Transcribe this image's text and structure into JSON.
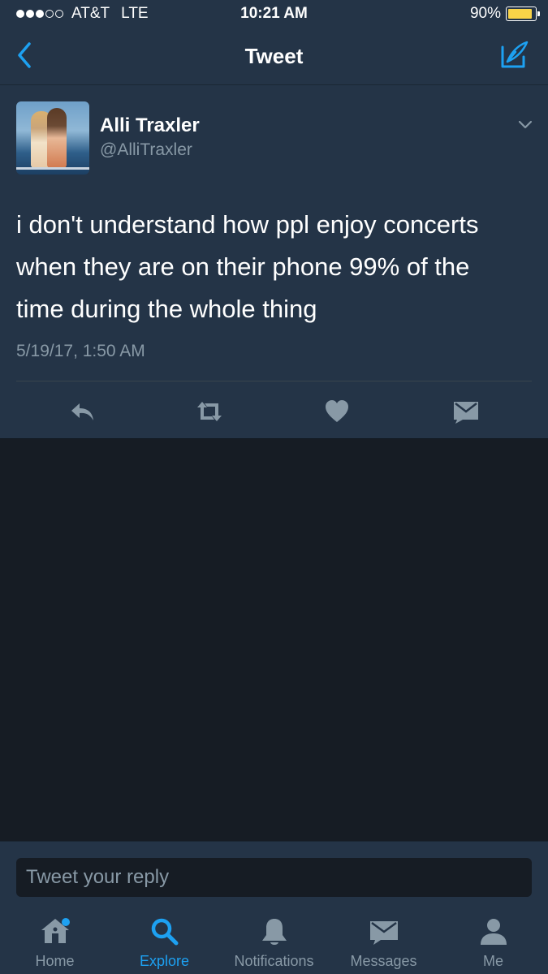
{
  "status_bar": {
    "carrier": "AT&T",
    "network": "LTE",
    "time": "10:21 AM",
    "battery": "90%",
    "signal_bars_filled": 3,
    "signal_bars_total": 5,
    "battery_level": 0.9
  },
  "nav": {
    "title": "Tweet",
    "back_icon": "chevron-left-icon",
    "compose_icon": "compose-icon"
  },
  "tweet": {
    "author_name": "Alli Traxler",
    "author_handle": "@AlliTraxler",
    "text": "i don't understand how ppl enjoy concerts when they are on their phone 99% of the time during the whole thing",
    "timestamp": "5/19/17, 1:50 AM",
    "actions": [
      "reply-icon",
      "retweet-icon",
      "like-icon",
      "direct-message-icon"
    ]
  },
  "reply": {
    "placeholder": "Tweet your reply"
  },
  "tabs": [
    {
      "label": "Home",
      "icon": "home-icon",
      "has_notification_dot": true
    },
    {
      "label": "Explore",
      "icon": "search-icon",
      "active": true
    },
    {
      "label": "Notifications",
      "icon": "bell-icon"
    },
    {
      "label": "Messages",
      "icon": "envelope-icon"
    },
    {
      "label": "Me",
      "icon": "person-icon"
    }
  ],
  "colors": {
    "accent": "#1da1f2",
    "background": "#161c24",
    "card": "#243447",
    "muted_text": "#8899a6",
    "battery_fill": "#f8d348"
  }
}
